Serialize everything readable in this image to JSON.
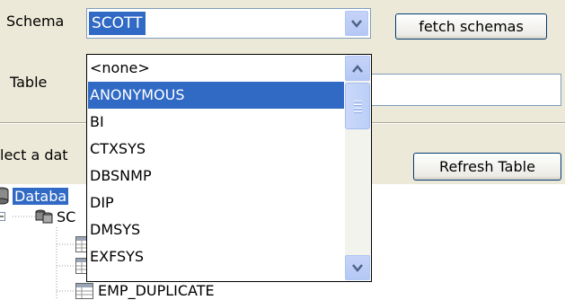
{
  "schema_label": "Schema",
  "schema_value": "SCOTT",
  "fetch_schemas_label": "fetch schemas",
  "table_label": "Table",
  "select_hint": "lect a dat",
  "refresh_table_label": "Refresh Table",
  "dropdown_options": [
    "<none>",
    "ANONYMOUS",
    "BI",
    "CTXSYS",
    "DBSNMP",
    "DIP",
    "DMSYS",
    "EXFSYS"
  ],
  "dropdown_selected_index": 1,
  "tree": {
    "root_label": "Databa",
    "schema_node_label": "SC",
    "visible_table_label": "EMP_DUPLICATE"
  },
  "icons": {
    "combo_arrow": "chevron-down-icon",
    "scroll_up": "scroll-up-arrow-icon",
    "scroll_down": "scroll-down-arrow-icon",
    "database": "database-icon",
    "schema": "schema-icon",
    "table": "table-icon",
    "tree_expander": "tree-expander-icon"
  },
  "colors": {
    "selection": "#316AC5",
    "window_bg": "#ECE9D8",
    "field_border": "#7F9DB9"
  }
}
